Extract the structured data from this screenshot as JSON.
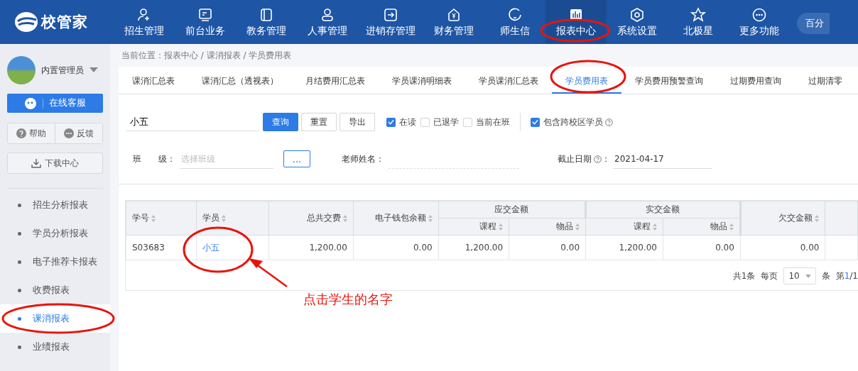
{
  "header": {
    "logo": "校管家",
    "nav": [
      {
        "label": "招生管理",
        "selected": false
      },
      {
        "label": "前台业务",
        "selected": false
      },
      {
        "label": "教务管理",
        "selected": false
      },
      {
        "label": "人事管理",
        "selected": false
      },
      {
        "label": "进销存管理",
        "selected": false
      },
      {
        "label": "财务管理",
        "selected": false
      },
      {
        "label": "师生信",
        "selected": false
      },
      {
        "label": "报表中心",
        "selected": true
      },
      {
        "label": "系统设置",
        "selected": false
      },
      {
        "label": "北极星",
        "selected": false
      },
      {
        "label": "更多功能",
        "selected": false
      }
    ],
    "campus": "百分"
  },
  "sidebar": {
    "user": "内置管理员",
    "service_button": "在线客服",
    "help": "帮助",
    "feedback": "反馈",
    "download": "下载中心",
    "items": [
      {
        "label": "招生分析报表",
        "selected": false
      },
      {
        "label": "学员分析报表",
        "selected": false
      },
      {
        "label": "电子推荐卡报表",
        "selected": false
      },
      {
        "label": "收费报表",
        "selected": false
      },
      {
        "label": "课消报表",
        "selected": true
      },
      {
        "label": "业绩报表",
        "selected": false
      }
    ]
  },
  "breadcrumb": "当前位置：报表中心 / 课消报表 / 学员费用表",
  "tabs": [
    {
      "label": "课消汇总表",
      "selected": false
    },
    {
      "label": "课消汇总（透视表）",
      "selected": false
    },
    {
      "label": "月结费用汇总表",
      "selected": false
    },
    {
      "label": "学员课消明细表",
      "selected": false
    },
    {
      "label": "学员课消汇总表",
      "selected": false
    },
    {
      "label": "学员费用表",
      "selected": true
    },
    {
      "label": "学员费用预警查询",
      "selected": false
    },
    {
      "label": "过期费用查询",
      "selected": false
    },
    {
      "label": "过期清零",
      "selected": false
    }
  ],
  "filters": {
    "search": {
      "value": "小五"
    },
    "buttons": [
      {
        "label": "查询",
        "kind": "primary"
      },
      {
        "label": "重置",
        "kind": "default"
      },
      {
        "label": "导出",
        "kind": "default"
      }
    ],
    "checks": [
      {
        "label": "在读",
        "checked": true
      },
      {
        "label": "已退学",
        "checked": false
      },
      {
        "label": "当前在班",
        "checked": false
      }
    ],
    "cross_campus": {
      "label": "包含跨校区学员",
      "checked": true
    },
    "class_label_1": "班",
    "class_label_2": "级：",
    "class_field": {
      "placeholder": "选择班级"
    },
    "more_button": "...",
    "teacher_label": "老师姓名：",
    "date_label": "截止日期",
    "date_colon": "：",
    "date_value": "2021-04-17"
  },
  "table": {
    "column_groups": [
      {
        "label": "应交金额"
      },
      {
        "label": "实交金额"
      }
    ],
    "columns": [
      "学号",
      "学员",
      "总共交费",
      "电子钱包余额",
      "课程",
      "物品",
      "课程",
      "物品",
      "欠交金额"
    ],
    "rows": [
      [
        "S03683",
        "小五",
        "1,200.00",
        "0.00",
        "1,200.00",
        "0.00",
        "1,200.00",
        "0.00",
        "0.00"
      ]
    ]
  },
  "pagination": {
    "total": "共1条",
    "per_page_label": "每页",
    "per_page": "10",
    "unit": "条",
    "page_prefix": "第",
    "page_current": "1",
    "page_rest": "/1"
  },
  "annotation": {
    "note": "点击学生的名字"
  }
}
